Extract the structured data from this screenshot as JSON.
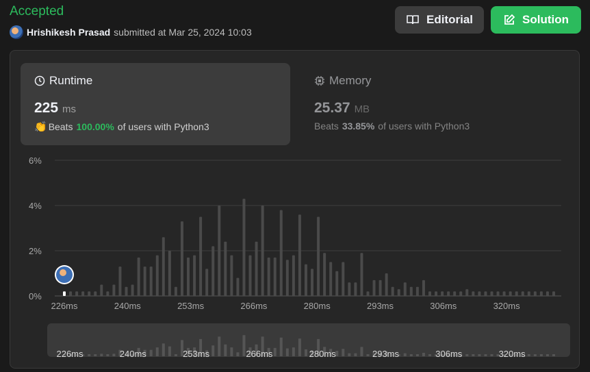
{
  "header": {
    "status": "Accepted",
    "username": "Hrishikesh Prasad",
    "submitted_text": "submitted at Mar 25, 2024 10:03",
    "editorial_label": "Editorial",
    "solution_label": "Solution"
  },
  "runtime": {
    "title": "Runtime",
    "value": "225",
    "unit": "ms",
    "beats_label": "Beats",
    "beats_pct": "100.00%",
    "beats_suffix": "of users with Python3"
  },
  "memory": {
    "title": "Memory",
    "value": "25.37",
    "unit": "MB",
    "beats_label": "Beats",
    "beats_pct": "33.85%",
    "beats_suffix": "of users with Python3"
  },
  "colors": {
    "accepted": "#2cbb5d",
    "bar": "#4a4a4a",
    "highlight_bar": "#ffffff"
  },
  "chart_data": {
    "type": "bar",
    "ylim": [
      0,
      6
    ],
    "y_ticks": [
      "0%",
      "2%",
      "4%",
      "6%"
    ],
    "x_tick_labels": [
      "226ms",
      "240ms",
      "253ms",
      "266ms",
      "280ms",
      "293ms",
      "306ms",
      "320ms"
    ],
    "grid": true,
    "user_bar_index": 0,
    "values": [
      0.2,
      0.2,
      0.2,
      0.2,
      0.2,
      0.2,
      0.5,
      0.2,
      0.5,
      1.3,
      0.4,
      0.5,
      1.7,
      1.3,
      1.3,
      1.8,
      2.6,
      2.0,
      0.4,
      3.3,
      1.7,
      1.8,
      3.5,
      1.2,
      2.2,
      4.0,
      2.4,
      1.8,
      0.8,
      4.3,
      1.8,
      2.4,
      4.0,
      1.7,
      1.7,
      3.8,
      1.6,
      1.8,
      3.6,
      1.4,
      1.2,
      3.5,
      1.9,
      1.5,
      1.1,
      1.5,
      0.6,
      0.6,
      1.9,
      0.2,
      0.7,
      0.7,
      1.0,
      0.4,
      0.3,
      0.6,
      0.4,
      0.4,
      0.7,
      0.2,
      0.2,
      0.2,
      0.2,
      0.2,
      0.2,
      0.3,
      0.2,
      0.2,
      0.2,
      0.2,
      0.2,
      0.2,
      0.2,
      0.2,
      0.2,
      0.2,
      0.2,
      0.2,
      0.2,
      0.2
    ]
  }
}
